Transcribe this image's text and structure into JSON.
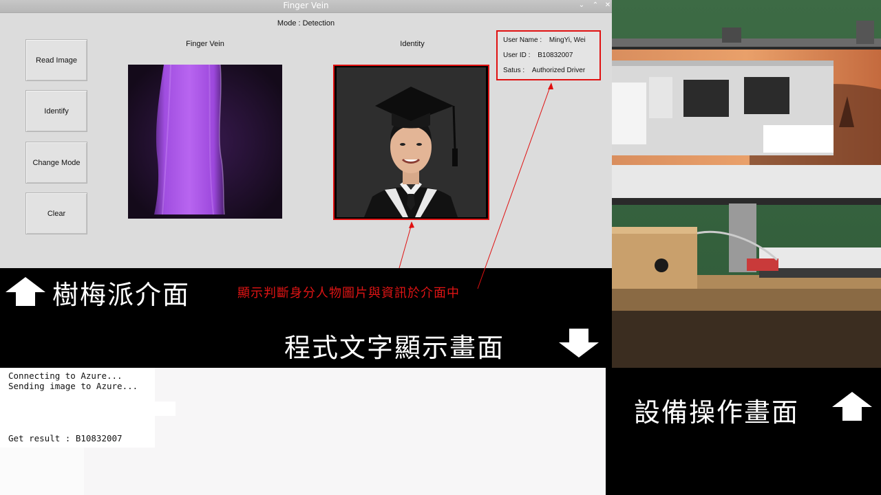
{
  "window": {
    "title": "Finger Vein",
    "controls": {
      "minimize": "⌄",
      "maximize": "⌃",
      "close": "✕"
    }
  },
  "mode_label": "Mode : Detection",
  "buttons": {
    "read_image": "Read Image",
    "identify": "Identify",
    "change_mode": "Change Mode",
    "clear": "Clear"
  },
  "panels": {
    "finger_vein_title": "Finger Vein",
    "identity_title": "Identity"
  },
  "info": {
    "name_label": "User Name :",
    "name_value": "MingYi, Wei",
    "id_label": "User ID :",
    "id_value": "B10832007",
    "status_label": "Satus :",
    "status_value": "Authorized Driver"
  },
  "captions": {
    "pi_interface": "樹梅派介面",
    "annotation": "顯示判斷身分人物圖片與資訊於介面中",
    "console_screen": "程式文字顯示畫面",
    "device_screen": "設備操作畫面"
  },
  "terminal": {
    "line1": "Connecting to Azure...",
    "line2": "Sending image to Azure...",
    "line3": "Get result : B10832007"
  },
  "colors": {
    "highlight_red": "#e01010",
    "annotation_red": "#e01414",
    "window_bg": "#dcdcdc",
    "vein_purple": "#a24fe0"
  }
}
